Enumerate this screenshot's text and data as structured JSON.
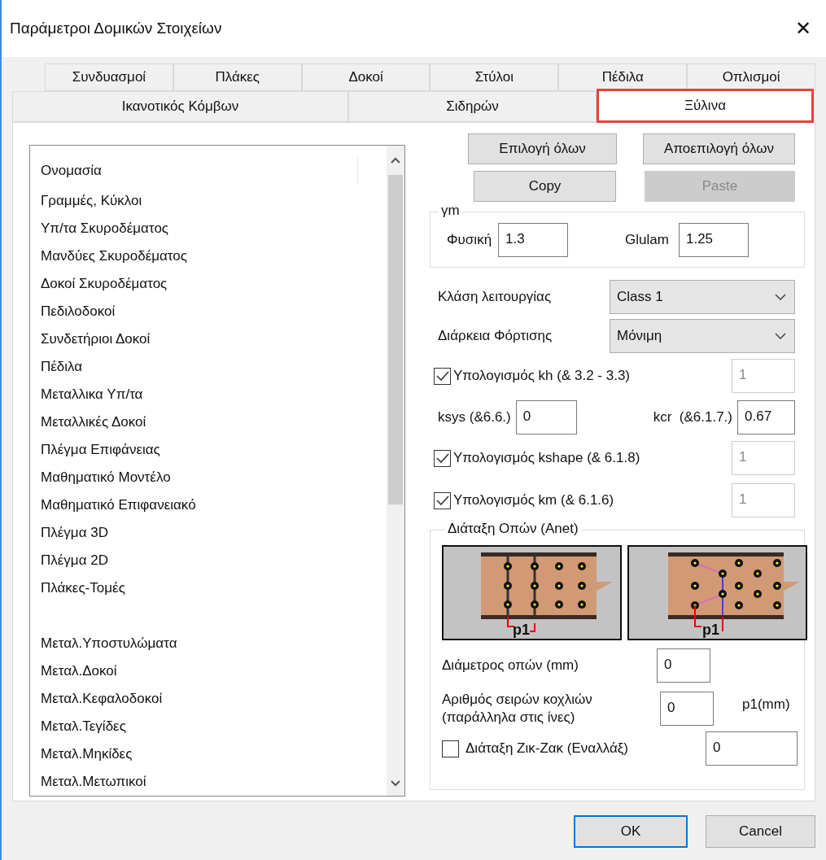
{
  "window": {
    "title": "Παράμετροι Δομικών Στοιχείων",
    "close": "✕"
  },
  "tab_rows": [
    [
      {
        "label": "Συνδυασμοί",
        "selected": false
      },
      {
        "label": "Πλάκες",
        "selected": false
      },
      {
        "label": "Δοκοί",
        "selected": false
      },
      {
        "label": "Στύλοι",
        "selected": false
      },
      {
        "label": "Πέδιλα",
        "selected": false
      },
      {
        "label": "Οπλισμοί",
        "selected": false
      }
    ],
    [
      {
        "label": "Ικανοτικός Κόμβων",
        "selected": false
      },
      {
        "label": "Σιδηρών",
        "selected": false
      },
      {
        "label": "Ξύλινα",
        "selected": true
      }
    ]
  ],
  "list": {
    "header": "Ονομασία",
    "groups": [
      [
        "Γραμμές, Κύκλοι",
        "Υπ/τα Σκυροδέματος",
        "Μανδύες Σκυροδέματος",
        "Δοκοί Σκυροδέματος",
        "Πεδιλοδοκοί",
        "Συνδετήριοι Δοκοί",
        "Πέδιλα",
        "Μεταλλικα Υπ/τα",
        "Μεταλλικές Δοκοί",
        "Πλέγμα Επιφάνειας",
        "Μαθηματικό Μοντέλο",
        "Μαθηματικό Επιφανειακό",
        "Πλέγμα 3D",
        "Πλέγμα 2D",
        "Πλάκες-Τομές"
      ],
      [
        "Μεταλ.Υποστυλώματα",
        "Μεταλ.Δοκοί",
        "Μεταλ.Κεφαλοδοκοί",
        "Μεταλ.Τεγίδες",
        "Μεταλ.Μηκίδες",
        "Μεταλ.Μετωπικοί"
      ]
    ]
  },
  "buttons": [
    {
      "label": "Επιλογή όλων",
      "disabled": false
    },
    {
      "label": "Αποεπιλογή όλων",
      "disabled": false
    },
    {
      "label": "Copy",
      "disabled": false
    },
    {
      "label": "Paste",
      "disabled": true
    }
  ],
  "gamma_m": {
    "legend": "γm",
    "fields": [
      {
        "label": "Φυσική",
        "value": "1.3"
      },
      {
        "label": "Glulam",
        "value": "1.25"
      }
    ]
  },
  "dropdowns": [
    {
      "label": "Κλάση λειτουργίας",
      "value": "Class 1"
    },
    {
      "label": "Διάρκεια Φόρτισης",
      "value": "Μόνιμη"
    }
  ],
  "rows": [
    {
      "kind": "checkbox",
      "label": "Υπολογισμός kh (& 3.2 - 3.3)",
      "checked": true,
      "value": "1",
      "disabled": true
    },
    {
      "kind": "pair",
      "fields": [
        {
          "label": "ksys (&6.6.)",
          "value": "0",
          "disabled": false
        },
        {
          "label": "kcr  (&6.1.7.)",
          "value": "0.67",
          "disabled": false
        }
      ]
    },
    {
      "kind": "checkbox",
      "label": "Υπολογισμός kshape (& 6.1.8)",
      "checked": true,
      "value": "1",
      "disabled": true
    },
    {
      "kind": "checkbox",
      "label": "Υπολογισμός km (& 6.1.6)",
      "checked": true,
      "value": "1",
      "disabled": true
    }
  ],
  "holes": {
    "legend": "Διάταξη Οπών (Anet)",
    "diagrams": [
      {
        "kind": "grid",
        "label": "p1"
      },
      {
        "kind": "staggered",
        "label": "p1"
      }
    ],
    "diameter": {
      "label": "Διάμετρος οπών (mm)",
      "value": "0"
    },
    "bolt_rows": {
      "label_lines": [
        "Αριθμός σειρών κοχλιών",
        "(παράλληλα στις ίνες)"
      ],
      "value": "0"
    },
    "p1": {
      "label": "p1(mm)",
      "value": "0"
    },
    "zigzag": {
      "label": "Διάταξη Ζικ-Ζακ (Εναλλάξ)",
      "checked": false
    }
  },
  "footer": [
    {
      "label": "OK",
      "default": true
    },
    {
      "label": "Cancel",
      "default": false
    }
  ]
}
